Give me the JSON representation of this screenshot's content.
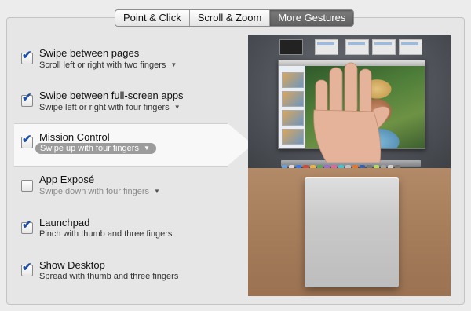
{
  "tabs": [
    {
      "label": "Point & Click",
      "active": false
    },
    {
      "label": "Scroll & Zoom",
      "active": false
    },
    {
      "label": "More Gestures",
      "active": true
    }
  ],
  "options": [
    {
      "title": "Swipe between pages",
      "subtitle": "Scroll left or right with two fingers",
      "checked": true,
      "has_menu": true
    },
    {
      "title": "Swipe between full-screen apps",
      "subtitle": "Swipe left or right with four fingers",
      "checked": true,
      "has_menu": true
    },
    {
      "title": "Mission Control",
      "subtitle": "Swipe up with four fingers",
      "checked": true,
      "has_menu": true,
      "selected": true
    },
    {
      "title": "App Exposé",
      "subtitle": "Swipe down with four fingers",
      "checked": false,
      "has_menu": true
    },
    {
      "title": "Launchpad",
      "subtitle": "Pinch with thumb and three fingers",
      "checked": true,
      "has_menu": false
    },
    {
      "title": "Show Desktop",
      "subtitle": "Spread with thumb and three fingers",
      "checked": true,
      "has_menu": false
    }
  ],
  "icons": {
    "checkmark": "✔",
    "popup_arrow": "▼"
  },
  "colors": {
    "checkmark": "#1f4fa3",
    "active_tab": "#6a6a6a",
    "selected_pill": "#9c9c9c"
  }
}
